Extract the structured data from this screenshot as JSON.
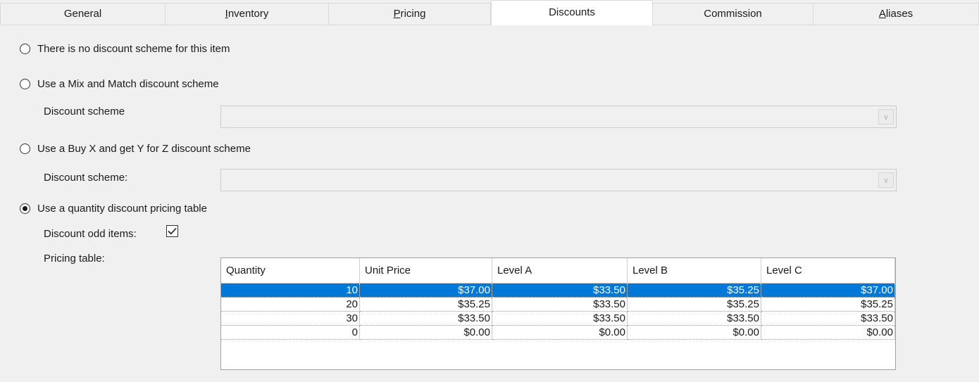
{
  "tabs": [
    {
      "label": "General",
      "underline_index": -1
    },
    {
      "label": "Inventory",
      "underline_index": 0
    },
    {
      "label": "Pricing",
      "underline_index": 0
    },
    {
      "label": "Discounts",
      "underline_index": -1
    },
    {
      "label": "Commission",
      "underline_index": -1
    },
    {
      "label": "Aliases",
      "underline_index": 0
    }
  ],
  "active_tab": "Discounts",
  "options": {
    "no_scheme": {
      "label": "There is no discount scheme for this item",
      "checked": false
    },
    "mix_match": {
      "label": "Use a Mix and Match discount scheme",
      "checked": false,
      "scheme_label": "Discount scheme",
      "scheme_value": ""
    },
    "buy_x_get_y": {
      "label": "Use a Buy X and get Y for Z discount scheme",
      "checked": false,
      "scheme_label": "Discount scheme:",
      "scheme_value": ""
    },
    "quantity_table": {
      "label": "Use a quantity discount pricing table",
      "checked": true
    }
  },
  "discount_odd_items": {
    "label": "Discount odd items:",
    "checked": true
  },
  "pricing_table": {
    "label": "Pricing table:",
    "columns": [
      "Quantity",
      "Unit Price",
      "Level A",
      "Level B",
      "Level C"
    ],
    "rows": [
      [
        "10",
        "$37.00",
        "$33.50",
        "$35.25",
        "$37.00"
      ],
      [
        "20",
        "$35.25",
        "$33.50",
        "$35.25",
        "$35.25"
      ],
      [
        "30",
        "$33.50",
        "$33.50",
        "$33.50",
        "$33.50"
      ],
      [
        "0",
        "$0.00",
        "$0.00",
        "$0.00",
        "$0.00"
      ]
    ],
    "selected_row": 0
  },
  "colors": {
    "selection": "#0078d7",
    "panel": "#f0f0f0",
    "active_tab": "#ffffff"
  }
}
